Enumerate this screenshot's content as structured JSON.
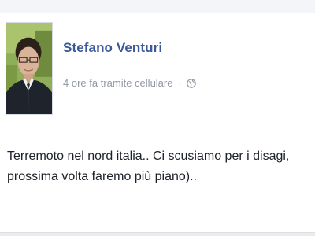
{
  "post": {
    "author": "Stefano Venturi",
    "time": "4 ore fa",
    "via": "tramite cellulare",
    "separator": "·",
    "privacy_icon": "globe-icon",
    "text_line1": "Terremoto nel nord italia.. Ci scusiamo per i disagi,",
    "text_line2": "prossima volta faremo più piano).."
  },
  "colors": {
    "name": "#3b5998",
    "meta": "#9197a3",
    "text": "#1d2129"
  }
}
